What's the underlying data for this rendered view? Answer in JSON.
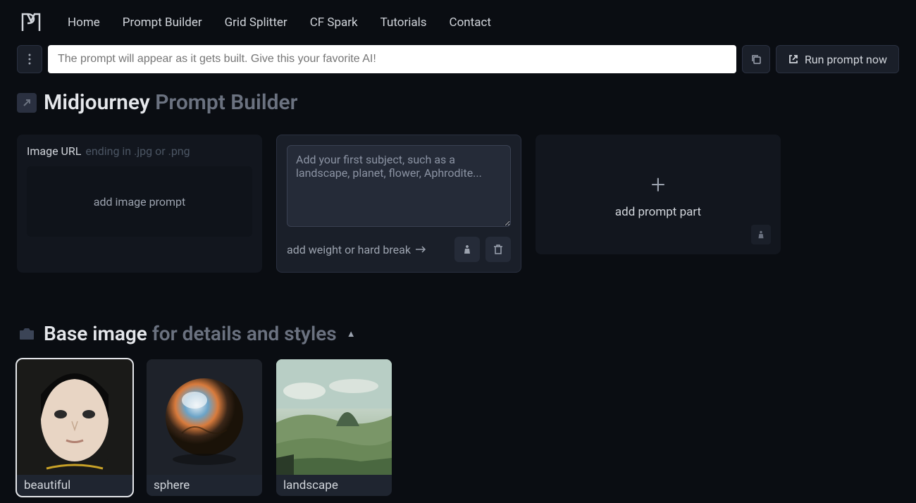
{
  "nav": {
    "links": [
      "Home",
      "Prompt Builder",
      "Grid Splitter",
      "CF Spark",
      "Tutorials",
      "Contact"
    ]
  },
  "promptBar": {
    "placeholder": "The prompt will appear as it gets built. Give this your favorite AI!",
    "runLabel": "Run prompt now"
  },
  "pageTitle": {
    "bold": "Midjourney",
    "muted": "Prompt Builder"
  },
  "cards": {
    "imageUrl": {
      "label": "Image URL",
      "hint": "ending in .jpg or .png",
      "dropLabel": "add image prompt"
    },
    "subject": {
      "placeholder": "Add your first subject, such as a landscape, planet, flower, Aphrodite...",
      "weightLabel": "add weight or hard break"
    },
    "addPart": {
      "label": "add prompt part"
    }
  },
  "baseImage": {
    "titleBold": "Base image",
    "titleMuted": "for details and styles",
    "thumbs": [
      {
        "label": "beautiful"
      },
      {
        "label": "sphere"
      },
      {
        "label": "landscape"
      }
    ]
  }
}
